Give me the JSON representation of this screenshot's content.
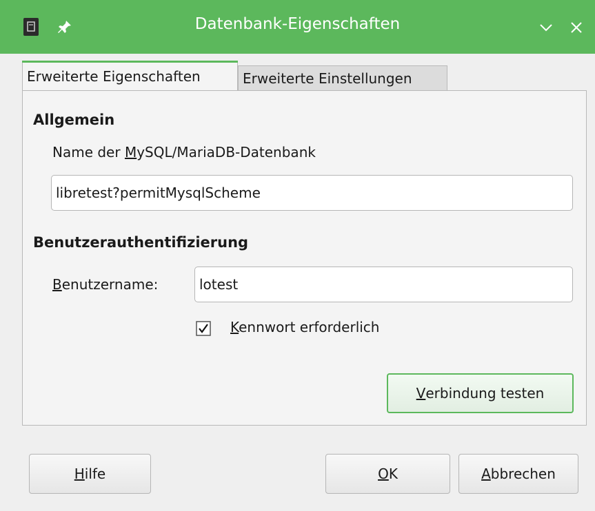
{
  "window": {
    "title": "Datenbank-Eigenschaften"
  },
  "tabs": [
    {
      "label": "Erweiterte Eigenschaften",
      "active": true
    },
    {
      "label": "Erweiterte Einstellungen",
      "active": false
    }
  ],
  "general": {
    "heading": "Allgemein",
    "db_label_pre": "Name der ",
    "db_label_mnemonic": "M",
    "db_label_post": "ySQL/MariaDB-Datenbank",
    "db_value": "libretest?permitMysqlScheme"
  },
  "auth": {
    "heading": "Benutzerauthentifizierung",
    "user_label_mnemonic": "B",
    "user_label_rest": "enutzername:",
    "user_value": "lotest",
    "password_required_mnemonic": "K",
    "password_required_rest": "ennwort erforderlich",
    "password_required_checked": true
  },
  "test_button": {
    "mnemonic": "V",
    "rest": "erbindung testen"
  },
  "footer": {
    "help": {
      "mnemonic": "H",
      "rest": "ilfe"
    },
    "ok": {
      "mnemonic": "O",
      "rest": "K"
    },
    "cancel": {
      "mnemonic": "A",
      "rest": "bbrechen"
    }
  },
  "colors": {
    "accent": "#5cb85c",
    "background": "#efefef"
  }
}
